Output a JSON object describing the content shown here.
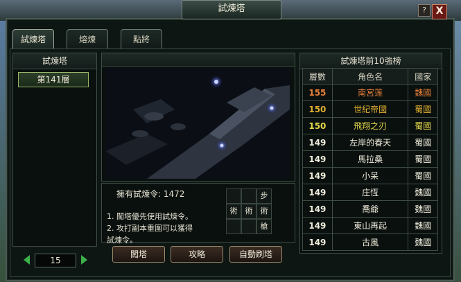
{
  "window": {
    "title": "試煉塔",
    "help_label": "?",
    "close_label": "X"
  },
  "tabs": [
    {
      "label": "試煉塔",
      "active": true
    },
    {
      "label": "熔煉",
      "active": false
    },
    {
      "label": "點將",
      "active": false
    }
  ],
  "left_panel": {
    "title": "試煉塔",
    "selected_floor": "第141層",
    "page": "15"
  },
  "info": {
    "tokens_label": "擁有試煉令:",
    "tokens_value": "1472",
    "rule_1": "1. 闖塔優先使用試煉令。",
    "rule_2a": "2. 攻打副本重圍可以獲得",
    "rule_2b": "試煉令。"
  },
  "grid": [
    [
      "",
      "",
      "步"
    ],
    [
      "術",
      "術",
      "術"
    ],
    [
      "",
      "",
      "槍"
    ]
  ],
  "buttons": {
    "challenge": "闖塔",
    "guide": "攻略",
    "auto": "自動刷塔"
  },
  "ranking": {
    "title": "試煉塔前10強榜",
    "columns": [
      "層數",
      "角色名",
      "國家"
    ],
    "rows": [
      {
        "floor": "155",
        "name": "南宮莲",
        "country": "魏國",
        "color": "#e8803a"
      },
      {
        "floor": "150",
        "name": "世紀帝國",
        "country": "蜀國",
        "color": "#e0b030"
      },
      {
        "floor": "150",
        "name": "飛翔之刃",
        "country": "蜀國",
        "color": "#e6d84a"
      },
      {
        "floor": "149",
        "name": "左岸的春天",
        "country": "蜀國",
        "color": "#f0ecdc"
      },
      {
        "floor": "149",
        "name": "馬拉桑",
        "country": "蜀國",
        "color": "#f0ecdc"
      },
      {
        "floor": "149",
        "name": "小呆",
        "country": "蜀國",
        "color": "#f0ecdc"
      },
      {
        "floor": "149",
        "name": "庄恆",
        "country": "魏國",
        "color": "#f0ecdc"
      },
      {
        "floor": "149",
        "name": "喬爺",
        "country": "魏國",
        "color": "#f0ecdc"
      },
      {
        "floor": "149",
        "name": "東山再起",
        "country": "魏國",
        "color": "#f0ecdc"
      },
      {
        "floor": "149",
        "name": "古風",
        "country": "魏國",
        "color": "#f0ecdc"
      }
    ]
  }
}
